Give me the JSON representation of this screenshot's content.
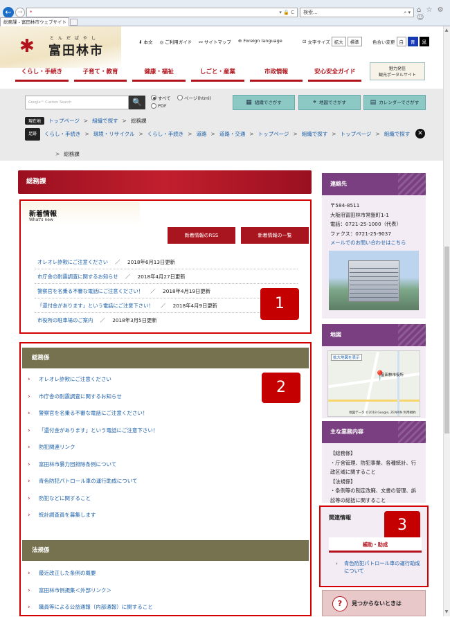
{
  "browser": {
    "back_icon": "back-arrow-icon",
    "forward_icon": "forward-arrow-icon",
    "address": "*",
    "address_controls": "▾ 🔒 C",
    "search_placeholder": "検索...",
    "search_icon": "⌕ ▾",
    "toolbar_icons": "⌂ ☆ ⚙ ☺",
    "tab_title": "総務課 - 富田林市ウェブサイト"
  },
  "header": {
    "logo_ruby": "とんだばやし",
    "logo_name": "富田林市",
    "logo_mark": "✱",
    "util_links": [
      "本文",
      "ご利用ガイド",
      "サイトマップ",
      "Foreign language"
    ],
    "util_icons": [
      "⬇",
      "◎",
      "⚯",
      "⊕"
    ],
    "fontsize_label": "文字サイズ",
    "fontsize_icon": "⊡",
    "fontsize_buttons": [
      "拡大",
      "標準"
    ],
    "color_label": "色合い変更",
    "color_buttons": [
      "白",
      "青",
      "黒"
    ],
    "nav": [
      "くらし・手続き",
      "子育て・教育",
      "健康・福祉",
      "しごと・産業",
      "市政情報",
      "安心安全ガイド"
    ],
    "portal_line1": "魅力発信",
    "portal_line2": "観光ポータルサイト",
    "accent": "#b1121b"
  },
  "search": {
    "placeholder": "Google™ Custom Search",
    "button_icon": "🔍",
    "radio_all": "すべて",
    "radio_page": "ページ(html)",
    "radio_pdf": "PDF",
    "find_buttons": [
      {
        "label": "組織でさがす",
        "icon": "▦"
      },
      {
        "label": "地図でさがす",
        "icon": "⌖"
      },
      {
        "label": "カレンダーでさがす",
        "icon": "▤"
      }
    ]
  },
  "breadcrumb": {
    "current_tag": "現在地",
    "current": [
      "トップページ",
      "組織で探す",
      "総務課"
    ],
    "fixed_tag": "足跡",
    "trail": [
      "くらし・手続き",
      "環境・リサイクル",
      "くらし・手続き",
      "道路",
      "道路・交通",
      "トップページ",
      "組織で探す",
      "トップページ",
      "組織で探す",
      "総務課"
    ],
    "separator": ">",
    "close_icon": "✕"
  },
  "main": {
    "page_title": "総務課",
    "news": {
      "title": "新着情報",
      "subtitle": "What's new",
      "rss_button": "新着情報のRSS",
      "list_button": "新着情報の一覧",
      "items": [
        {
          "title": "オレオレ詐欺にご注意ください",
          "sep": "／",
          "date": "2018年6月13日更新"
        },
        {
          "title": "市庁舎の耐震調査に関するお知らせ",
          "sep": "／",
          "date": "2018年4月27日更新"
        },
        {
          "title": "警察官を名乗る不審な電話にご注意ください！",
          "sep": "／",
          "date": "2018年4月19日更新"
        },
        {
          "title": "「還付金があります」という電話にご注意下さい！",
          "sep": "／",
          "date": "2018年4月9日更新"
        },
        {
          "title": "市役所の駐車場のご案内",
          "sep": "／",
          "date": "2018年3月5日更新"
        }
      ]
    },
    "markers": [
      "1",
      "2",
      "3"
    ],
    "soumu": {
      "title": "総務係",
      "items": [
        "オレオレ詐欺にご注意ください",
        "市庁舎の耐震調査に関するお知らせ",
        "警察官を名乗る不審な電話にご注意ください！",
        "「還付金があります」という電話にご注意下さい！",
        "防犯関連リンク",
        "富田林市暴力団排除条例について",
        "青色防犯パトロール車の運行助成について",
        "防犯などに関すること",
        "統計調査員を募集します"
      ]
    },
    "houki": {
      "title": "法規係",
      "items": [
        "最近改正した条例の概要",
        "富田林市例規集＜外部リンク＞",
        "職員等による公益通報（内部通報）に関すること"
      ]
    },
    "chevron": "›"
  },
  "side": {
    "contact": {
      "title": "連絡先",
      "lines": [
        "〒584-8511",
        "大阪府富田林市常盤町1-1",
        "電話：0721-25-1000（代表）",
        "ファクス：0721-25-9037"
      ],
      "mail_link": "メールでのお問い合わせはこちら"
    },
    "map": {
      "title": "地図",
      "enlarge": "拡大地図を表示",
      "pin_label": "富田林市役所",
      "pin_icon": "📍",
      "copyright": "地図データ ©2018 Google, ZENRIN 利用規約"
    },
    "duty": {
      "title": "主な業務内容",
      "lines": [
        "【総務係】",
        "・庁舎管理、防犯事業、各種統計、行政区域に関すること",
        "【法規係】",
        "・条例等の制定改廃、文書の管理、訴訟等の総括に関すること"
      ]
    },
    "related": {
      "title": "関連情報",
      "tab": "補助・助成",
      "link": "青色防犯パトロール車の運行助成について",
      "link_icon": "›"
    },
    "notfound": {
      "label": "見つからないときは",
      "icon": "?"
    }
  },
  "scrollbar": {
    "up": "▲",
    "down": "▼"
  }
}
